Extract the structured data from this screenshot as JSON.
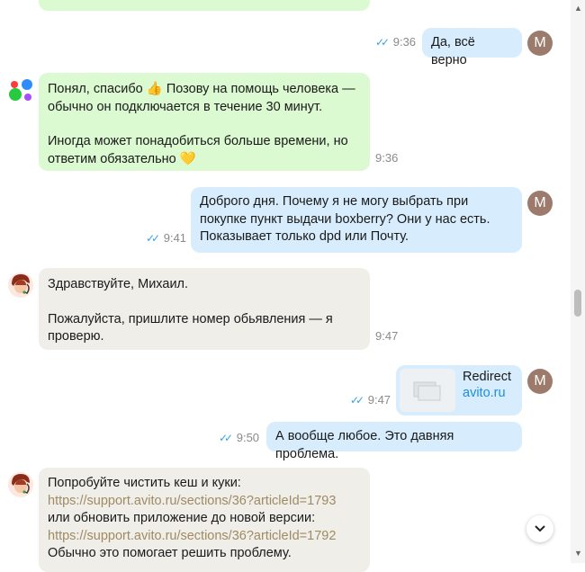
{
  "messages": {
    "m1": {
      "text": "Да, всё верно",
      "time": "9:36",
      "avatar": "М"
    },
    "m2": {
      "line1": "Понял, спасибо 👍 Позову на помощь человека —",
      "line2": "обычно он подключается в течение 30 минут.",
      "line3": "Иногда может понадобиться больше времени, но",
      "line4": "ответим обязательно 💛",
      "time": "9:36"
    },
    "m3": {
      "line1": "Доброго дня. Почему я не могу выбрать при",
      "line2": "покупке пункт выдачи boxberry? Они у нас есть.",
      "line3": "Показывает только dpd или Почту.",
      "time": "9:41",
      "avatar": "М"
    },
    "m4": {
      "line1": "Здравствуйте, Михаил.",
      "line2": "Пожалуйста, пришлите номер обьявления — я",
      "line3": "проверю.",
      "time": "9:47"
    },
    "m5": {
      "title": "Redirect",
      "domain": "avito.ru",
      "time": "9:47",
      "avatar": "М"
    },
    "m6": {
      "text": "А вообще любое. Это давняя проблема.",
      "time": "9:50"
    },
    "m7": {
      "line1": "Попробуйте чистить кеш и куки:",
      "link1": "https://support.avito.ru/sections/36?articleId=1793",
      "line2": "или обновить приложение до новой версии:",
      "link2": "https://support.avito.ru/sections/36?articleId=1792",
      "line3": "Обычно это помогает решить проблему."
    }
  },
  "colors": {
    "outgoing_bubble": "#d7ecfd",
    "bot_bubble": "#dcfad1",
    "support_bubble": "#f0eee9",
    "read_ticks": "#3aa0e8",
    "link": "#a08a62",
    "user_avatar": "#9c7b6d"
  },
  "icons": {
    "read_receipt": "double-check-icon",
    "bot_avatar": "avito-dots-logo",
    "support_avatar": "support-agent-icon",
    "scroll_down": "chevron-down-icon",
    "link_preview": "image-placeholder-icon"
  }
}
